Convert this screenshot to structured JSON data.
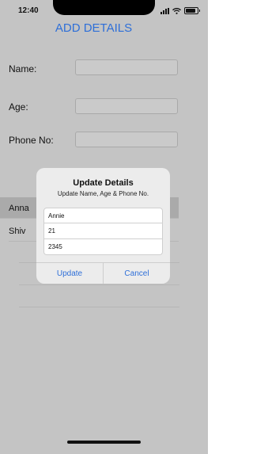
{
  "status_bar": {
    "time": "12:40",
    "icons": [
      "cellular-signal-icon",
      "wifi-icon",
      "battery-icon"
    ]
  },
  "header": {
    "title": "ADD DETAILS"
  },
  "form": {
    "name_label": "Name:",
    "age_label": "Age:",
    "phone_label": "Phone No:",
    "name_value": "",
    "age_value": "",
    "phone_value": ""
  },
  "list": {
    "items": [
      {
        "label": "Anna",
        "selected": true
      },
      {
        "label": "Shiv",
        "selected": false
      }
    ]
  },
  "alert": {
    "title": "Update Details",
    "message": "Update Name, Age & Phone No.",
    "fields": [
      {
        "value": "Annie"
      },
      {
        "value": "21"
      },
      {
        "value": "2345"
      }
    ],
    "update_label": "Update",
    "cancel_label": "Cancel"
  },
  "colors": {
    "accent": "#2e6fd8",
    "dim_background": "#c4c4c4",
    "alert_background": "#ececec",
    "selected_row": "#aaaaaa"
  }
}
